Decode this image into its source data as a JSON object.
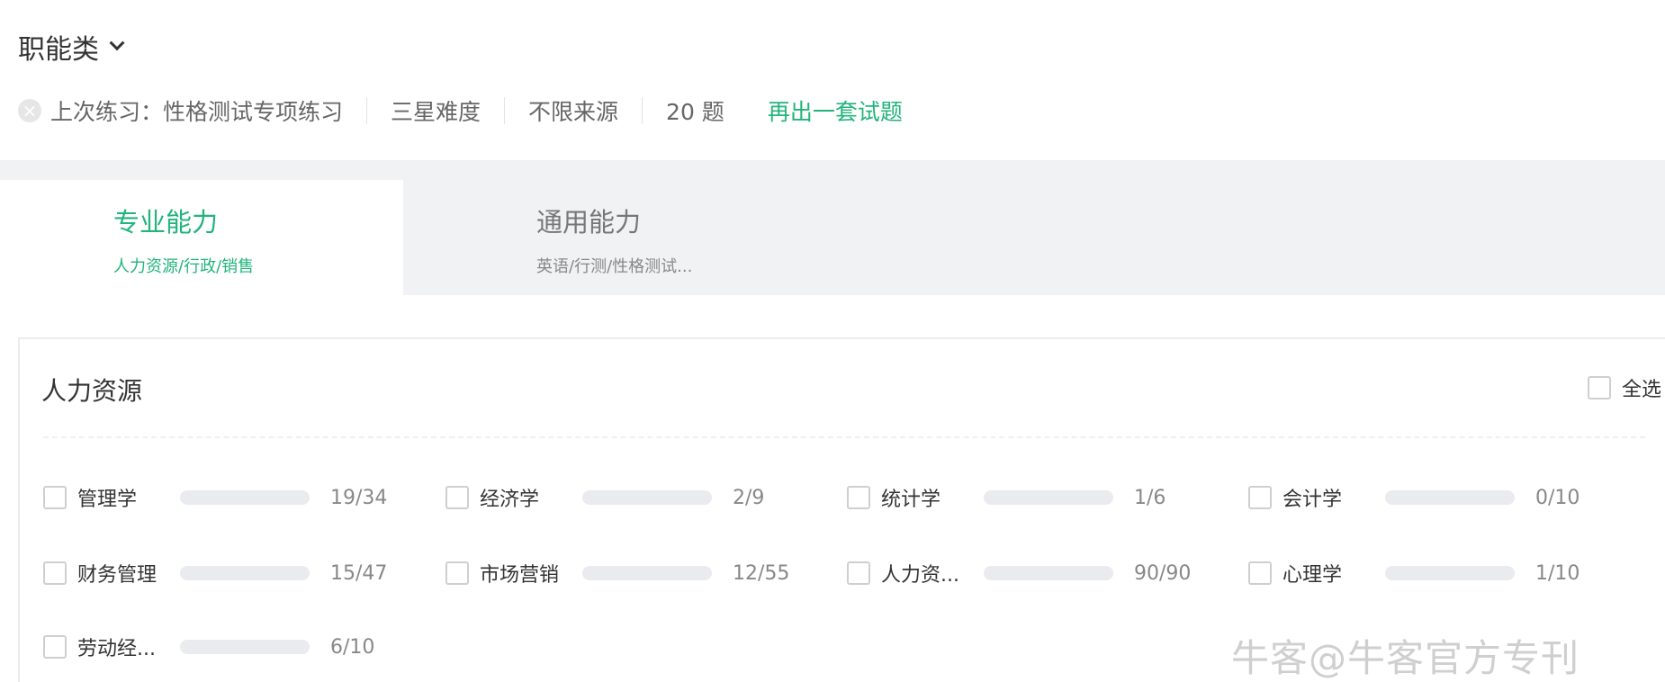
{
  "header": {
    "category": "职能类"
  },
  "last_practice": {
    "label": "上次练习：性格测试专项练习",
    "difficulty": "三星难度",
    "source": "不限来源",
    "count": "20 题",
    "again": "再出一套试题"
  },
  "tabs": [
    {
      "title": "专业能力",
      "sub": "人力资源/行政/销售"
    },
    {
      "title": "通用能力",
      "sub": "英语/行测/性格测试..."
    }
  ],
  "section": {
    "title": "人力资源",
    "select_all": "全选"
  },
  "subjects": [
    {
      "name": "管理学",
      "done": 19,
      "total": 34,
      "count": "19/34"
    },
    {
      "name": "经济学",
      "done": 2,
      "total": 9,
      "count": "2/9"
    },
    {
      "name": "统计学",
      "done": 1,
      "total": 6,
      "count": "1/6"
    },
    {
      "name": "会计学",
      "done": 0,
      "total": 10,
      "count": "0/10"
    },
    {
      "name": "财务管理",
      "done": 15,
      "total": 47,
      "count": "15/47"
    },
    {
      "name": "市场营销",
      "done": 12,
      "total": 55,
      "count": "12/55"
    },
    {
      "name": "人力资...",
      "done": 90,
      "total": 90,
      "count": "90/90"
    },
    {
      "name": "心理学",
      "done": 1,
      "total": 10,
      "count": "1/10"
    },
    {
      "name": "劳动经...",
      "done": 6,
      "total": 10,
      "count": "6/10"
    }
  ],
  "colors": {
    "accent": "#22b47c",
    "progress": "#ff6a4d",
    "track": "#e9ebee"
  },
  "watermark": "牛客@牛客官方专刊"
}
